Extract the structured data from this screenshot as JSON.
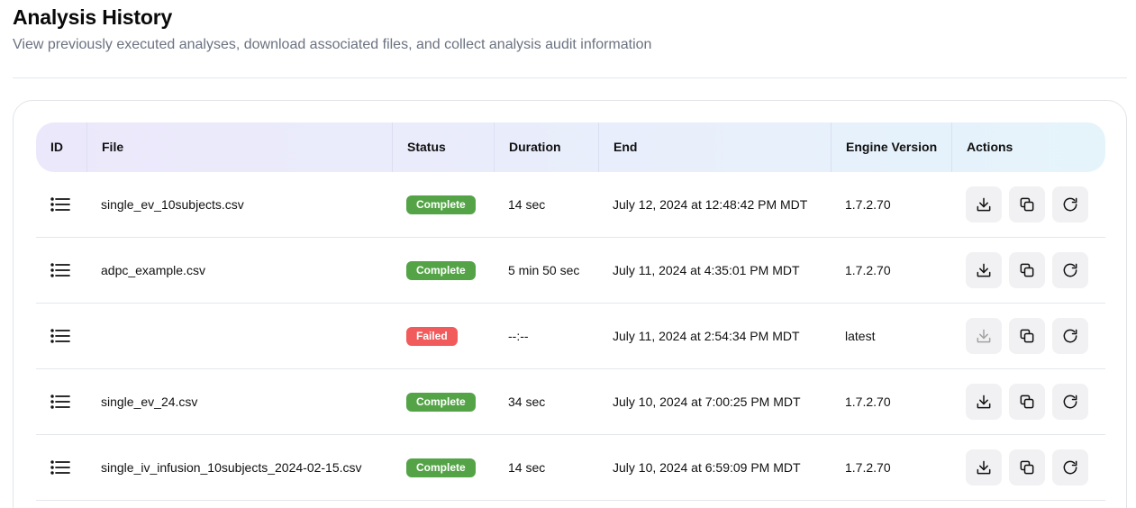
{
  "header": {
    "title": "Analysis History",
    "subtitle": "View previously executed analyses, download associated files, and collect analysis audit information"
  },
  "table": {
    "columns": {
      "id": "ID",
      "file": "File",
      "status": "Status",
      "duration": "Duration",
      "end": "End",
      "engine": "Engine Version",
      "actions": "Actions"
    },
    "rows": [
      {
        "file": "single_ev_10subjects.csv",
        "status": "Complete",
        "duration": "14 sec",
        "end": "July 12, 2024 at 12:48:42 PM MDT",
        "engine": "1.7.2.70",
        "download_enabled": true
      },
      {
        "file": "adpc_example.csv",
        "status": "Complete",
        "duration": "5 min 50 sec",
        "end": "July 11, 2024 at 4:35:01 PM MDT",
        "engine": "1.7.2.70",
        "download_enabled": true
      },
      {
        "file": "",
        "status": "Failed",
        "duration": "--:--",
        "end": "July 11, 2024 at 2:54:34 PM MDT",
        "engine": "latest",
        "download_enabled": false
      },
      {
        "file": "single_ev_24.csv",
        "status": "Complete",
        "duration": "34 sec",
        "end": "July 10, 2024 at 7:00:25 PM MDT",
        "engine": "1.7.2.70",
        "download_enabled": true
      },
      {
        "file": "single_iv_infusion_10subjects_2024-02-15.csv",
        "status": "Complete",
        "duration": "14 sec",
        "end": "July 10, 2024 at 6:59:09 PM MDT",
        "engine": "1.7.2.70",
        "download_enabled": true
      }
    ]
  },
  "colors": {
    "complete": "#54a447",
    "failed": "#f15b5b"
  },
  "icons": {
    "details": "list-icon",
    "download": "download-icon",
    "copy": "copy-icon",
    "rerun": "refresh-icon"
  }
}
